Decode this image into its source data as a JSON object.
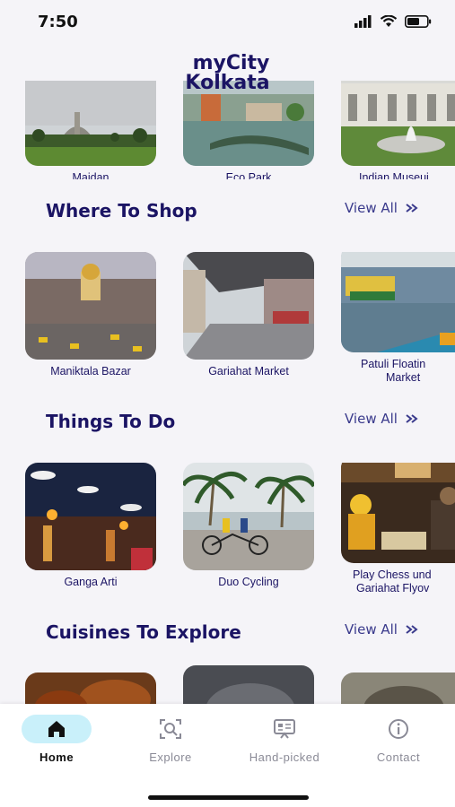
{
  "status_bar": {
    "time": "7:50"
  },
  "app": {
    "title_line1": "myCity",
    "title_line2": "Kolkata"
  },
  "top_row": [
    {
      "label": "Maidan"
    },
    {
      "label": "Eco Park"
    },
    {
      "label": "Indian Museui"
    }
  ],
  "sections": [
    {
      "title": "Where To Shop",
      "view_all": "View All",
      "items": [
        {
          "label": "Maniktala Bazar"
        },
        {
          "label": "Gariahat Market"
        },
        {
          "label": "Patuli Floatin­",
          "label2": "Market"
        }
      ]
    },
    {
      "title": "Things To Do",
      "view_all": "View All",
      "items": [
        {
          "label": "Ganga Arti"
        },
        {
          "label": "Duo Cycling"
        },
        {
          "label": "Play Chess und",
          "label2": "Gariahat Flyov"
        }
      ]
    },
    {
      "title": "Cuisines To Explore",
      "view_all": "View All"
    }
  ],
  "tabs": [
    {
      "label": "Home",
      "icon": "home-icon",
      "active": true
    },
    {
      "label": "Explore",
      "icon": "explore-icon"
    },
    {
      "label": "Hand-picked",
      "icon": "hand-picked-icon"
    },
    {
      "label": "Contact",
      "icon": "info-icon"
    }
  ],
  "colors": {
    "accent": "#1b1464",
    "tab_active_bg": "#c9f0fa",
    "background": "#f5f4f8"
  }
}
